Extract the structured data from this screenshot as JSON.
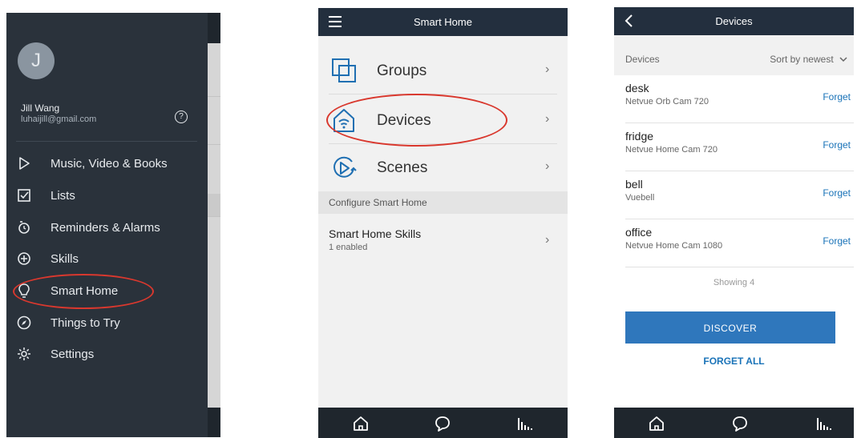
{
  "menu_screen": {
    "avatar_initial": "J",
    "user_name": "Jill Wang",
    "user_email": "luhaijill@gmail.com",
    "help_icon": "help-circle-icon",
    "items": [
      {
        "label": "Music, Video & Books",
        "icon": "play-icon"
      },
      {
        "label": "Lists",
        "icon": "checkbox-icon"
      },
      {
        "label": "Reminders & Alarms",
        "icon": "alarm-icon"
      },
      {
        "label": "Skills",
        "icon": "skills-icon"
      },
      {
        "label": "Smart Home",
        "icon": "lightbulb-icon"
      },
      {
        "label": "Things to Try",
        "icon": "compass-icon"
      },
      {
        "label": "Settings",
        "icon": "gear-icon"
      }
    ],
    "highlighted_item": "Smart Home"
  },
  "smart_home_screen": {
    "title": "Smart Home",
    "rows": [
      {
        "label": "Groups",
        "icon": "groups-icon"
      },
      {
        "label": "Devices",
        "icon": "devices-icon"
      },
      {
        "label": "Scenes",
        "icon": "scenes-icon"
      }
    ],
    "highlighted_row": "Devices",
    "section_header": "Configure Smart Home",
    "skills_row": {
      "title": "Smart Home Skills",
      "subtitle": "1 enabled"
    }
  },
  "devices_screen": {
    "title": "Devices",
    "list_header": "Devices",
    "sort_label": "Sort by newest",
    "devices": [
      {
        "name": "desk",
        "model": "Netvue Orb Cam 720",
        "action": "Forget"
      },
      {
        "name": "fridge",
        "model": "Netvue Home Cam 720",
        "action": "Forget"
      },
      {
        "name": "bell",
        "model": "Vuebell",
        "action": "Forget"
      },
      {
        "name": "office",
        "model": "Netvue Home Cam 1080",
        "action": "Forget"
      }
    ],
    "showing_text": "Showing 4",
    "discover_label": "DISCOVER",
    "forget_all_label": "FORGET ALL"
  },
  "bottom_nav": [
    "home-icon",
    "chat-icon",
    "activity-icon"
  ],
  "colors": {
    "drawer_bg": "#2a323b",
    "topbar_bg": "#232f3e",
    "accent_blue": "#2f77bc",
    "link_blue": "#1a73b8",
    "highlight_red": "#d9382e"
  }
}
